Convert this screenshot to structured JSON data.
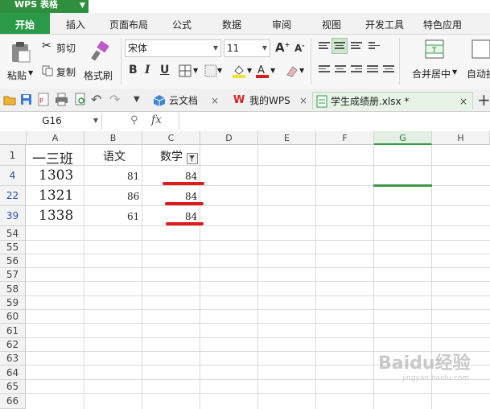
{
  "app": {
    "title": "WPS 表格"
  },
  "menu": {
    "tabs": [
      "开始",
      "插入",
      "页面布局",
      "公式",
      "数据",
      "审阅",
      "视图",
      "开发工具",
      "特色应用"
    ],
    "active_index": 0
  },
  "ribbon": {
    "paste_label": "粘贴",
    "cut_label": "剪切",
    "copy_label": "复制",
    "format_painter_label": "格式刷",
    "font_name": "宋体",
    "font_size": "11",
    "bold": "B",
    "italic": "I",
    "underline": "U",
    "merge_center_label": "合并居中",
    "auto_wrap_label": "自动换"
  },
  "doc_tabs": [
    {
      "label": "云文档",
      "closable": true
    },
    {
      "label": "我的WPS",
      "closable": true
    },
    {
      "label": "学生成绩册.xlsx *",
      "closable": true,
      "active": true
    }
  ],
  "formula_bar": {
    "name_box": "G16",
    "fx": "fx",
    "value": ""
  },
  "sheet": {
    "columns": [
      "A",
      "B",
      "C",
      "D",
      "E",
      "F",
      "G",
      "H"
    ],
    "selected_column": "G",
    "rows": [
      {
        "num": "1",
        "cells": [
          "一三班",
          "语文",
          "数学"
        ],
        "header": true
      },
      {
        "num": "4",
        "cells": [
          "1303",
          "81",
          "84"
        ]
      },
      {
        "num": "22",
        "cells": [
          "1321",
          "86",
          "84"
        ]
      },
      {
        "num": "39",
        "cells": [
          "1338",
          "61",
          "84"
        ]
      },
      {
        "num": "54"
      },
      {
        "num": "55"
      },
      {
        "num": "56"
      },
      {
        "num": "57"
      },
      {
        "num": "58"
      },
      {
        "num": "59"
      },
      {
        "num": "60"
      },
      {
        "num": "61"
      },
      {
        "num": "62"
      },
      {
        "num": "63"
      },
      {
        "num": "64"
      },
      {
        "num": "65"
      },
      {
        "num": "66"
      }
    ],
    "filtered_rows": [
      "4",
      "22",
      "39"
    ],
    "filter_column": "C",
    "active_cell": "G16"
  },
  "watermark": {
    "text": "Baidu经验",
    "sub": "jingyan.baidu.com"
  },
  "colors": {
    "accent": "#2a9a48",
    "underline": "#e0191b",
    "filtered_row_num": "#2450b5"
  }
}
